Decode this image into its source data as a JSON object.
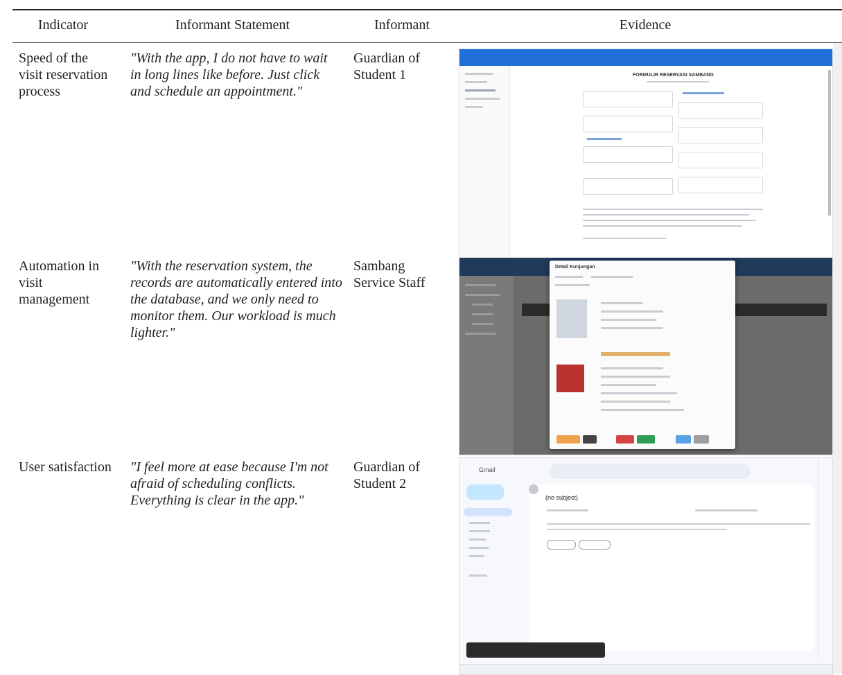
{
  "table": {
    "headers": [
      "Indicator",
      "Informant Statement",
      "Informant",
      "Evidence"
    ],
    "rows": [
      {
        "indicator": "Speed of the visit reservation process",
        "statement": "\"With the app, I do not have to wait in long lines like before. Just click and schedule an appointment.\"",
        "informant": "Guardian of Student 1"
      },
      {
        "indicator": "Automation in visit management",
        "statement": "\"With the reservation system, the records are automatically entered into the database, and we only need to monitor them. Our workload is much lighter.\"",
        "informant": "Sambang Service Staff"
      },
      {
        "indicator": "User satisfaction",
        "statement": "\"I feel more at ease because I'm not afraid of scheduling conflicts. Everything is clear in the app.\"",
        "informant": "Guardian of Student 2"
      }
    ]
  },
  "evidence": {
    "screenshot1": {
      "title": "FORMULIR RESERVASI SAMBANG",
      "accent": "#1f6fd6"
    },
    "screenshot2": {
      "modal_title": "Detail Kunjungan",
      "accent": "#203a5c"
    },
    "screenshot3": {
      "app": "Gmail",
      "subject": "(no subject)",
      "accent": "#c2e7ff"
    }
  }
}
